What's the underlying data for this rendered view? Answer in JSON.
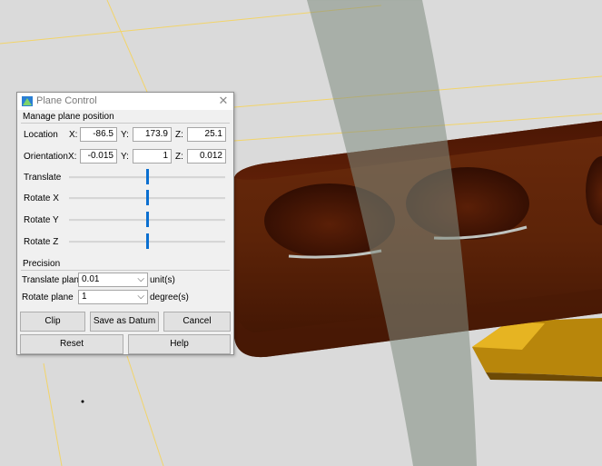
{
  "dialog": {
    "title": "Plane Control",
    "close_glyph": "✕",
    "section_label": "Manage plane position",
    "location": {
      "label": "Location",
      "x_label": "X:",
      "x": "-86.5",
      "y_label": "Y:",
      "y": "173.9",
      "z_label": "Z:",
      "z": "25.1"
    },
    "orientation": {
      "label": "Orientation",
      "x_label": "X:",
      "x": "-0.015",
      "y_label": "Y:",
      "y": "1",
      "z_label": "Z:",
      "z": "0.012"
    },
    "sliders": [
      {
        "label": "Translate",
        "level": 0.5
      },
      {
        "label": "Rotate X",
        "level": 0.5
      },
      {
        "label": "Rotate Y",
        "level": 0.5
      },
      {
        "label": "Rotate Z",
        "level": 0.5
      }
    ],
    "precision": {
      "label": "Precision",
      "translate_label": "Translate plane",
      "translate_value": "0.01",
      "translate_unit": "unit(s)",
      "rotate_label": "Rotate plane",
      "rotate_value": "1",
      "rotate_unit": "degree(s)"
    },
    "buttons": {
      "clip": "Clip",
      "save_datum": "Save as Datum",
      "cancel": "Cancel",
      "reset": "Reset",
      "help": "Help"
    }
  },
  "icons": {
    "app": "plane-control-app-icon",
    "close": "close-icon",
    "dropdown": "chevron-down-icon"
  },
  "colors": {
    "viewport_bg": "#dadada",
    "part": "#5a1c06",
    "plane": "#8c9a8a",
    "slider_thumb": "#0a6fd0",
    "axis_line": "#f0d060"
  }
}
